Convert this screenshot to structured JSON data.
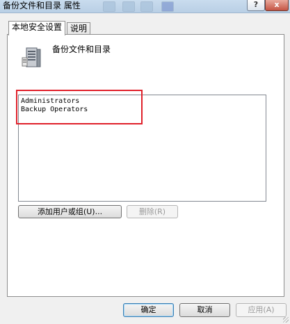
{
  "window": {
    "title": "备份文件和目录 属性",
    "help_glyph": "?",
    "close_glyph": "x"
  },
  "tabs": [
    {
      "label": "本地安全设置",
      "active": true
    },
    {
      "label": "说明",
      "active": false
    }
  ],
  "policy": {
    "icon": "server-icon",
    "name": "备份文件和目录"
  },
  "members": [
    "Administrators",
    "Backup Operators"
  ],
  "actions": {
    "add_label": "添加用户或组(U)...",
    "remove_label": "删除(R)"
  },
  "footer": {
    "ok_label": "确定",
    "cancel_label": "取消",
    "apply_label": "应用(A)"
  },
  "colors": {
    "highlight_box": "#e0202a",
    "titlebar": "#c9dcee",
    "close_button": "#c45444"
  }
}
